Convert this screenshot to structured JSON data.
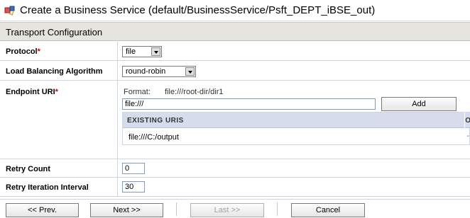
{
  "header": {
    "title": "Create a Business Service (default/BusinessService/Psft_DEPT_iBSE_out)",
    "icon": "business-service-icon"
  },
  "section": {
    "title": "Transport Configuration"
  },
  "form": {
    "protocol": {
      "label": "Protocol",
      "required_mark": "*",
      "value": "file"
    },
    "load_balancing": {
      "label": "Load Balancing Algorithm",
      "value": "round-robin"
    },
    "endpoint": {
      "label": "Endpoint URI",
      "required_mark": "*",
      "format_label": "Format:",
      "format_value": "file:///root-dir/dir1",
      "input_value": "file:///",
      "add_label": "Add",
      "table": {
        "headers": [
          "EXISTING URIS",
          "O"
        ],
        "rows": [
          [
            "file:///C:/output",
            "-"
          ]
        ]
      }
    },
    "retry_count": {
      "label": "Retry Count",
      "value": "0"
    },
    "retry_interval": {
      "label": "Retry Iteration Interval",
      "value": "30"
    }
  },
  "footer": {
    "prev_label": "<< Prev.",
    "next_label": "Next >>",
    "last_label": "Last >>",
    "cancel_label": "Cancel"
  },
  "colors": {
    "required": "#cc0000",
    "section_bg": "#e6e4df",
    "table_header_bg": "#d5dcec"
  }
}
